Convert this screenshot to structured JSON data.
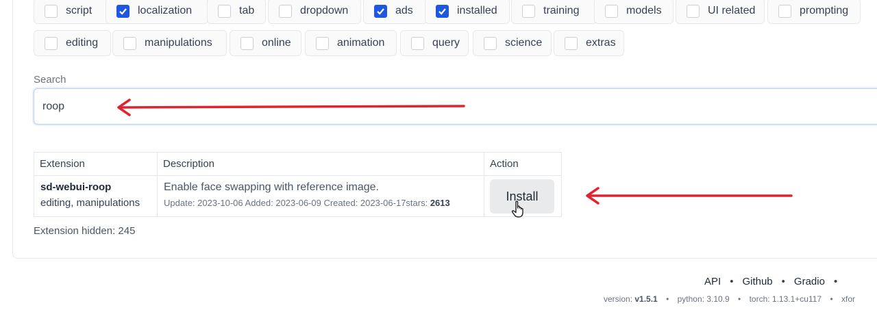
{
  "filters": [
    {
      "label": "script",
      "checked": false
    },
    {
      "label": "localization",
      "checked": true
    },
    {
      "label": "tab",
      "checked": false
    },
    {
      "label": "dropdown",
      "checked": false
    },
    {
      "label": "ads",
      "checked": true
    },
    {
      "label": "installed",
      "checked": true
    },
    {
      "label": "training",
      "checked": false
    },
    {
      "label": "models",
      "checked": false
    },
    {
      "label": "UI related",
      "checked": false
    },
    {
      "label": "prompting",
      "checked": false
    },
    {
      "label": "editing",
      "checked": false
    },
    {
      "label": "manipulations",
      "checked": false
    },
    {
      "label": "online",
      "checked": false
    },
    {
      "label": "animation",
      "checked": false
    },
    {
      "label": "query",
      "checked": false
    },
    {
      "label": "science",
      "checked": false
    },
    {
      "label": "extras",
      "checked": false
    }
  ],
  "search": {
    "label": "Search",
    "value": "roop"
  },
  "table": {
    "headers": [
      "Extension",
      "Description",
      "Action"
    ],
    "rows": [
      {
        "name": "sd-webui-roop",
        "tags": "editing, manipulations",
        "description": "Enable face swapping with reference image.",
        "meta": "Update: 2023-10-06 Added: 2023-06-09 Created: 2023-06-17stars: ",
        "stars": "2613",
        "action": "Install"
      }
    ]
  },
  "hidden_text": "Extension hidden: 245",
  "footer": {
    "links": [
      "API",
      "Github",
      "Gradio"
    ],
    "version_label": "version: ",
    "version_value": "v1.5.1",
    "python": "python: 3.10.9",
    "torch": "torch: 1.13.1+cu117",
    "xformers": "xfor"
  },
  "colors": {
    "accent": "#1f58e0",
    "annotation_arrow": "#e0242f"
  },
  "icons": {
    "checkbox_check": "check-icon",
    "pointer": "hand-cursor-icon",
    "annotation": "arrow-left-icon"
  }
}
